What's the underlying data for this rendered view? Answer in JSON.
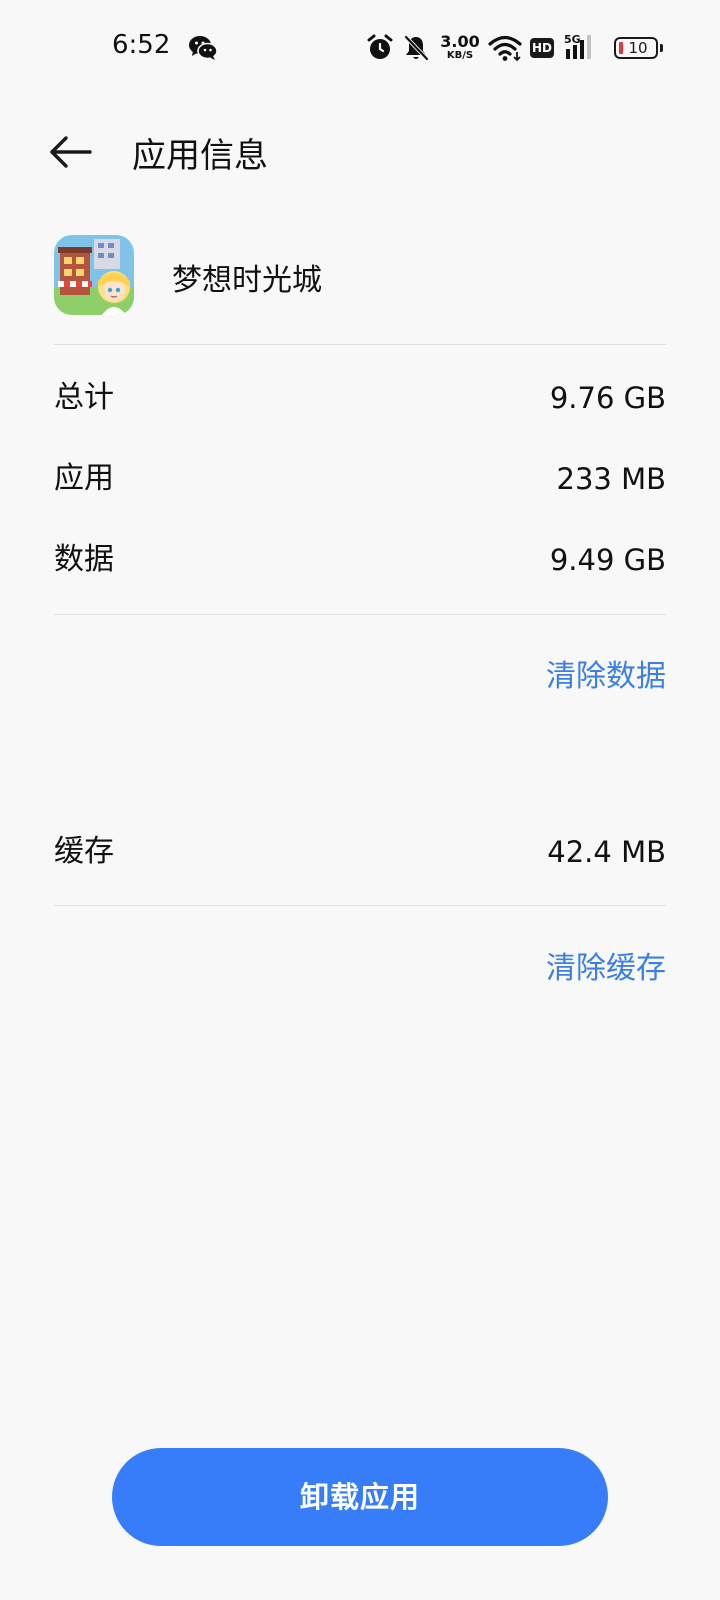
{
  "status_bar": {
    "time": "6:52",
    "net_speed_value": "3.00",
    "net_speed_unit": "KB/S",
    "hd_label": "HD",
    "network_label": "5G",
    "battery_level": "10",
    "icons": [
      "wechat-icon",
      "alarm-icon",
      "bell-off-icon",
      "wifi-icon",
      "hd-icon",
      "signal-icon",
      "battery-icon"
    ]
  },
  "header": {
    "title": "应用信息"
  },
  "app": {
    "name": "梦想时光城"
  },
  "storage": {
    "rows": [
      {
        "label": "总计",
        "value": "9.76 GB"
      },
      {
        "label": "应用",
        "value": "233 MB"
      },
      {
        "label": "数据",
        "value": "9.49 GB"
      }
    ],
    "clear_data_label": "清除数据",
    "cache_label": "缓存",
    "cache_value": "42.4 MB",
    "clear_cache_label": "清除缓存"
  },
  "actions": {
    "uninstall_label": "卸载应用"
  },
  "colors": {
    "accent_link": "#3b7fe2",
    "primary_button": "#377dfa",
    "background": "#f8f8f8",
    "battery_low": "#e53935"
  }
}
